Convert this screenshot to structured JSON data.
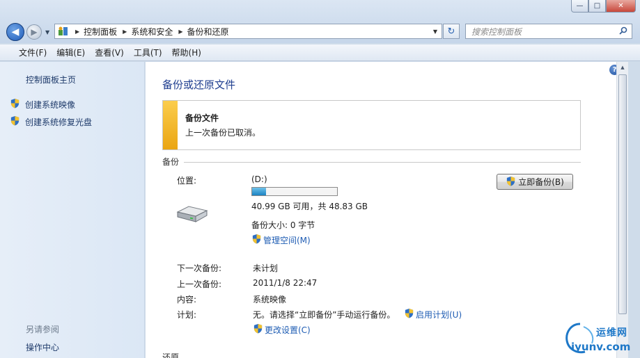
{
  "window": {
    "min": "—",
    "max": "□",
    "close": "✕"
  },
  "nav": {
    "breadcrumbs": [
      "控制面板",
      "系统和安全",
      "备份和还原"
    ],
    "search_placeholder": "搜索控制面板"
  },
  "menu": [
    "文件(F)",
    "编辑(E)",
    "查看(V)",
    "工具(T)",
    "帮助(H)"
  ],
  "sidebar": {
    "home": "控制面板主页",
    "links": [
      "创建系统映像",
      "创建系统修复光盘"
    ],
    "see_also": "另请参阅",
    "see_also_links": [
      "操作中心"
    ]
  },
  "main": {
    "title": "备份或还原文件",
    "notice": {
      "title": "备份文件",
      "text": "上一次备份已取消。"
    },
    "section_backup": "备份",
    "location_label": "位置:",
    "drive": "(D:)",
    "usage_fraction": 0.16,
    "space_text": "40.99 GB 可用，共 48.83 GB",
    "backup_size": "备份大小: 0 字节",
    "manage_space": "管理空间(M)",
    "backup_now": "立即备份(B)",
    "next_label": "下一次备份:",
    "next_value": "未计划",
    "last_label": "上一次备份:",
    "last_value": "2011/1/8 22:47",
    "contents_label": "内容:",
    "contents_value": "系统映像",
    "schedule_label": "计划:",
    "schedule_value": "无。请选择“立即备份”手动运行备份。",
    "enable_schedule": "启用计划(U)",
    "change_settings": "更改设置(C)",
    "section_restore": "还原"
  },
  "watermark": {
    "cn": "运维网",
    "en": "iyunv.com"
  },
  "colors": {
    "accent_link": "#1e5cb3",
    "title_blue": "#1e3d8f",
    "notice_bar": "#f2b72a"
  }
}
